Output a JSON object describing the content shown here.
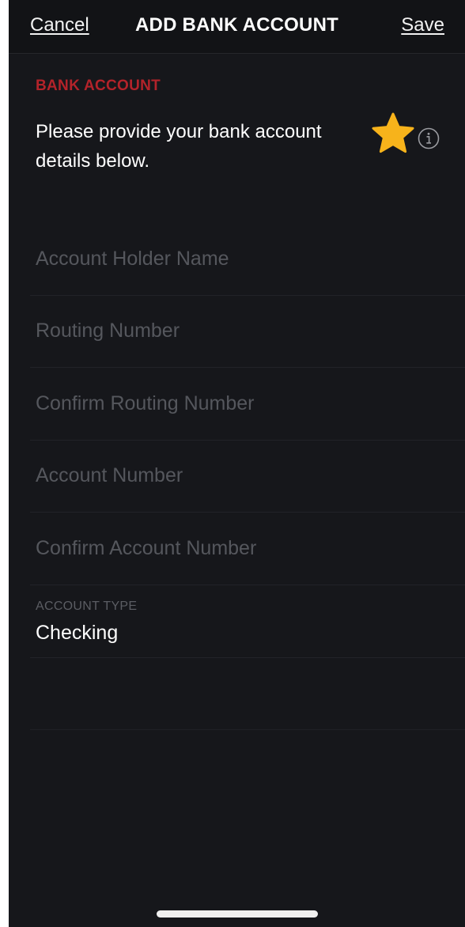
{
  "nav": {
    "cancel_label": "Cancel",
    "title": "ADD BANK ACCOUNT",
    "save_label": "Save"
  },
  "section": {
    "header": "BANK ACCOUNT",
    "intro": "Please provide your bank account details below.",
    "star_icon": "star-icon",
    "info_icon": "info-icon",
    "star_color": "#f7b31b",
    "accent_color": "#b3232a"
  },
  "fields": [
    {
      "placeholder": "Account Holder Name",
      "value": ""
    },
    {
      "placeholder": "Routing Number",
      "value": ""
    },
    {
      "placeholder": "Confirm Routing Number",
      "value": ""
    },
    {
      "placeholder": "Account Number",
      "value": ""
    },
    {
      "placeholder": "Confirm Account Number",
      "value": ""
    }
  ],
  "account_type": {
    "label": "ACCOUNT TYPE",
    "value": "Checking"
  }
}
